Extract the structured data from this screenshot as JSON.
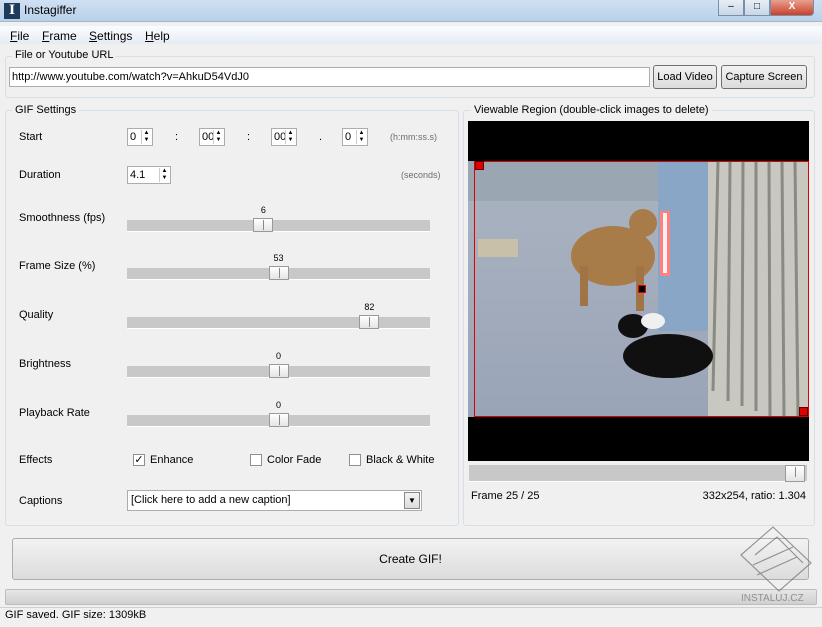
{
  "window": {
    "title": "Instagiffer",
    "minimize": "–",
    "maximize": "□",
    "close": "X"
  },
  "menu": [
    "File",
    "Frame",
    "Settings",
    "Help"
  ],
  "url_group": {
    "label": "File or Youtube URL",
    "value": "http://www.youtube.com/watch?v=AhkuD54VdJ0",
    "load_button": "Load Video",
    "capture_button": "Capture Screen"
  },
  "gif_settings": {
    "label": "GIF Settings",
    "start": {
      "label": "Start",
      "h": "0",
      "mm": "00",
      "ss": "00",
      "s": "0",
      "sep1": ":",
      "sep2": ":",
      "sep3": ".",
      "hint": "(h:mm:ss.s)"
    },
    "duration": {
      "label": "Duration",
      "value": "4.1",
      "hint": "(seconds)"
    },
    "sliders": [
      {
        "label": "Smoothness (fps)",
        "value": "6"
      },
      {
        "label": "Frame Size (%)",
        "value": "53"
      },
      {
        "label": "Quality",
        "value": "82"
      },
      {
        "label": "Brightness",
        "value": "0"
      },
      {
        "label": "Playback Rate",
        "value": "0"
      }
    ],
    "effects": {
      "label": "Effects",
      "options": [
        {
          "label": "Enhance",
          "checked": true
        },
        {
          "label": "Color Fade",
          "checked": false
        },
        {
          "label": "Black & White",
          "checked": false
        }
      ]
    },
    "captions": {
      "label": "Captions",
      "value": "[Click here to add a new caption]"
    }
  },
  "viewer": {
    "label": "Viewable Region (double-click images to delete)",
    "frame_text": "Frame  25 / 25",
    "frame_current": 25,
    "frame_total": 25,
    "size_text": "332x254, ratio: 1.304",
    "selection_color": "#e00000"
  },
  "create_button": "Create GIF!",
  "status": "GIF saved. GIF size: 1309kB",
  "watermark": "INSTALUJ.CZ"
}
